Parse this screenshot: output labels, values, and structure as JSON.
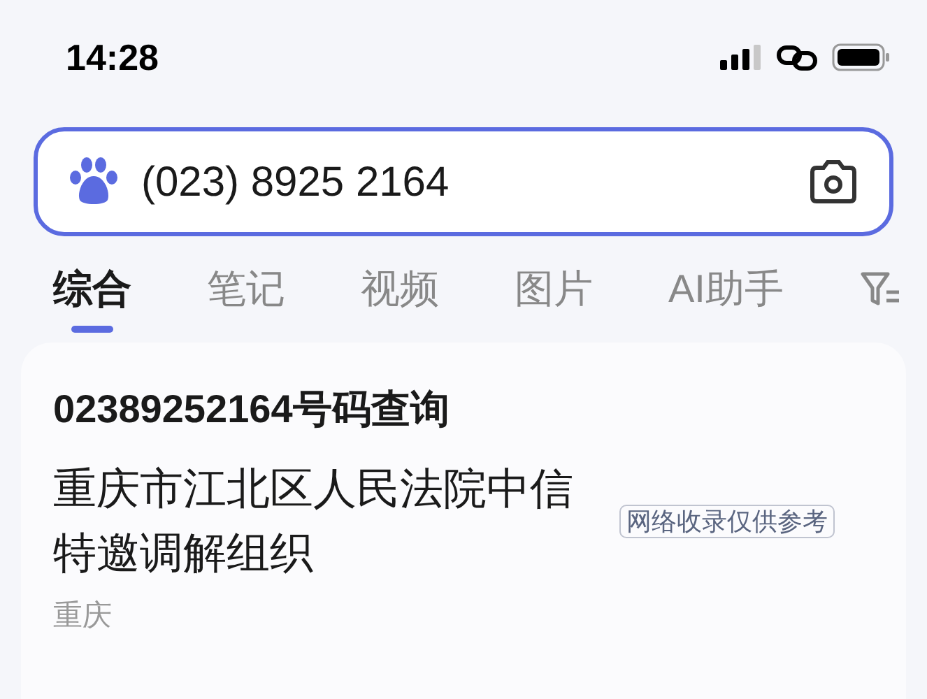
{
  "status_bar": {
    "time": "14:28"
  },
  "search": {
    "value": "(023) 8925 2164"
  },
  "tabs": [
    {
      "label": "综合",
      "selected": true
    },
    {
      "label": "笔记",
      "selected": false
    },
    {
      "label": "视频",
      "selected": false
    },
    {
      "label": "图片",
      "selected": false
    },
    {
      "label": "AI助手",
      "selected": false
    }
  ],
  "result": {
    "title": "02389252164号码查询",
    "name": "重庆市江北区人民法院中信特邀调解组织",
    "tag": "网络收录仅供参考",
    "location": "重庆"
  }
}
